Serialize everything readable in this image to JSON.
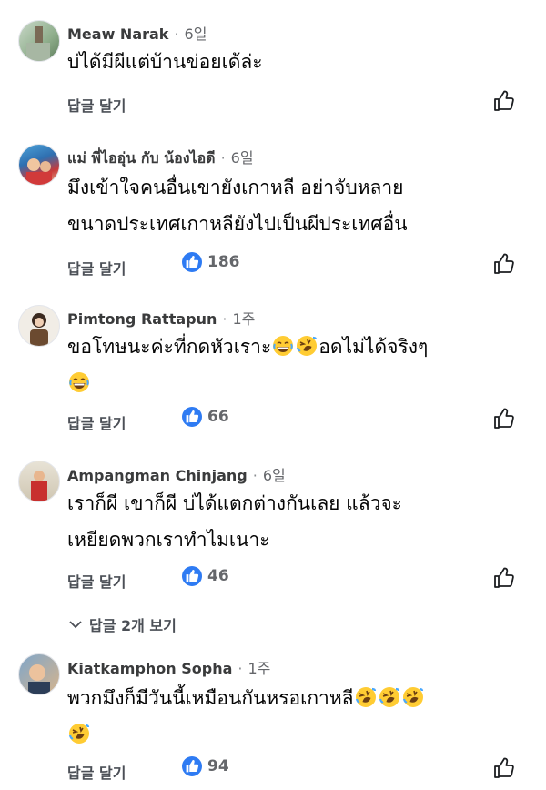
{
  "comments": [
    {
      "author": "Meaw Narak",
      "time": "6일",
      "lines": [
        "บ่ได้มีผีแต่บ้านข่อยเด้ล่ะ"
      ],
      "reply_label": "답글 달기",
      "likes": ""
    },
    {
      "author": "แม่ พี่ไออุ่น กับ น้องไอดี",
      "time": "6일",
      "lines": [
        "มึงเข้าใจคนอื่นเขายังเกาหลี อย่าจับหลาย",
        "ขนาดประเทศเกาหลียังไปเป็นผีประเทศอื่น"
      ],
      "reply_label": "답글 달기",
      "likes": "186"
    },
    {
      "author": "Pimtong Rattapun",
      "time": "1주",
      "lines": [
        "ขอโทษนะค่ะที่กดหัวเราะ",
        "อดไม่ได้จริงๆ"
      ],
      "reply_label": "답글 달기",
      "likes": "66"
    },
    {
      "author": "Ampangman Chinjang",
      "time": "6일",
      "lines": [
        "เราก็ผี เขาก็ผี บ่ได้แตกต่างกันเลย แล้วจะ",
        "เหยียดพวกเราทำไมเนาะ"
      ],
      "reply_label": "답글 달기",
      "likes": "46"
    },
    {
      "author": "Kiatkamphon Sopha",
      "time": "1주",
      "lines": [
        "พวกมึงก็มีวันนี้เหมือนกันหรอเกาหลี"
      ],
      "reply_label": "답글 달기",
      "likes": "94"
    }
  ],
  "view_replies": "답글 2개 보기",
  "colors": {
    "like_badge": "#2e7bf3",
    "text": "#050505",
    "meta": "#65676b"
  }
}
